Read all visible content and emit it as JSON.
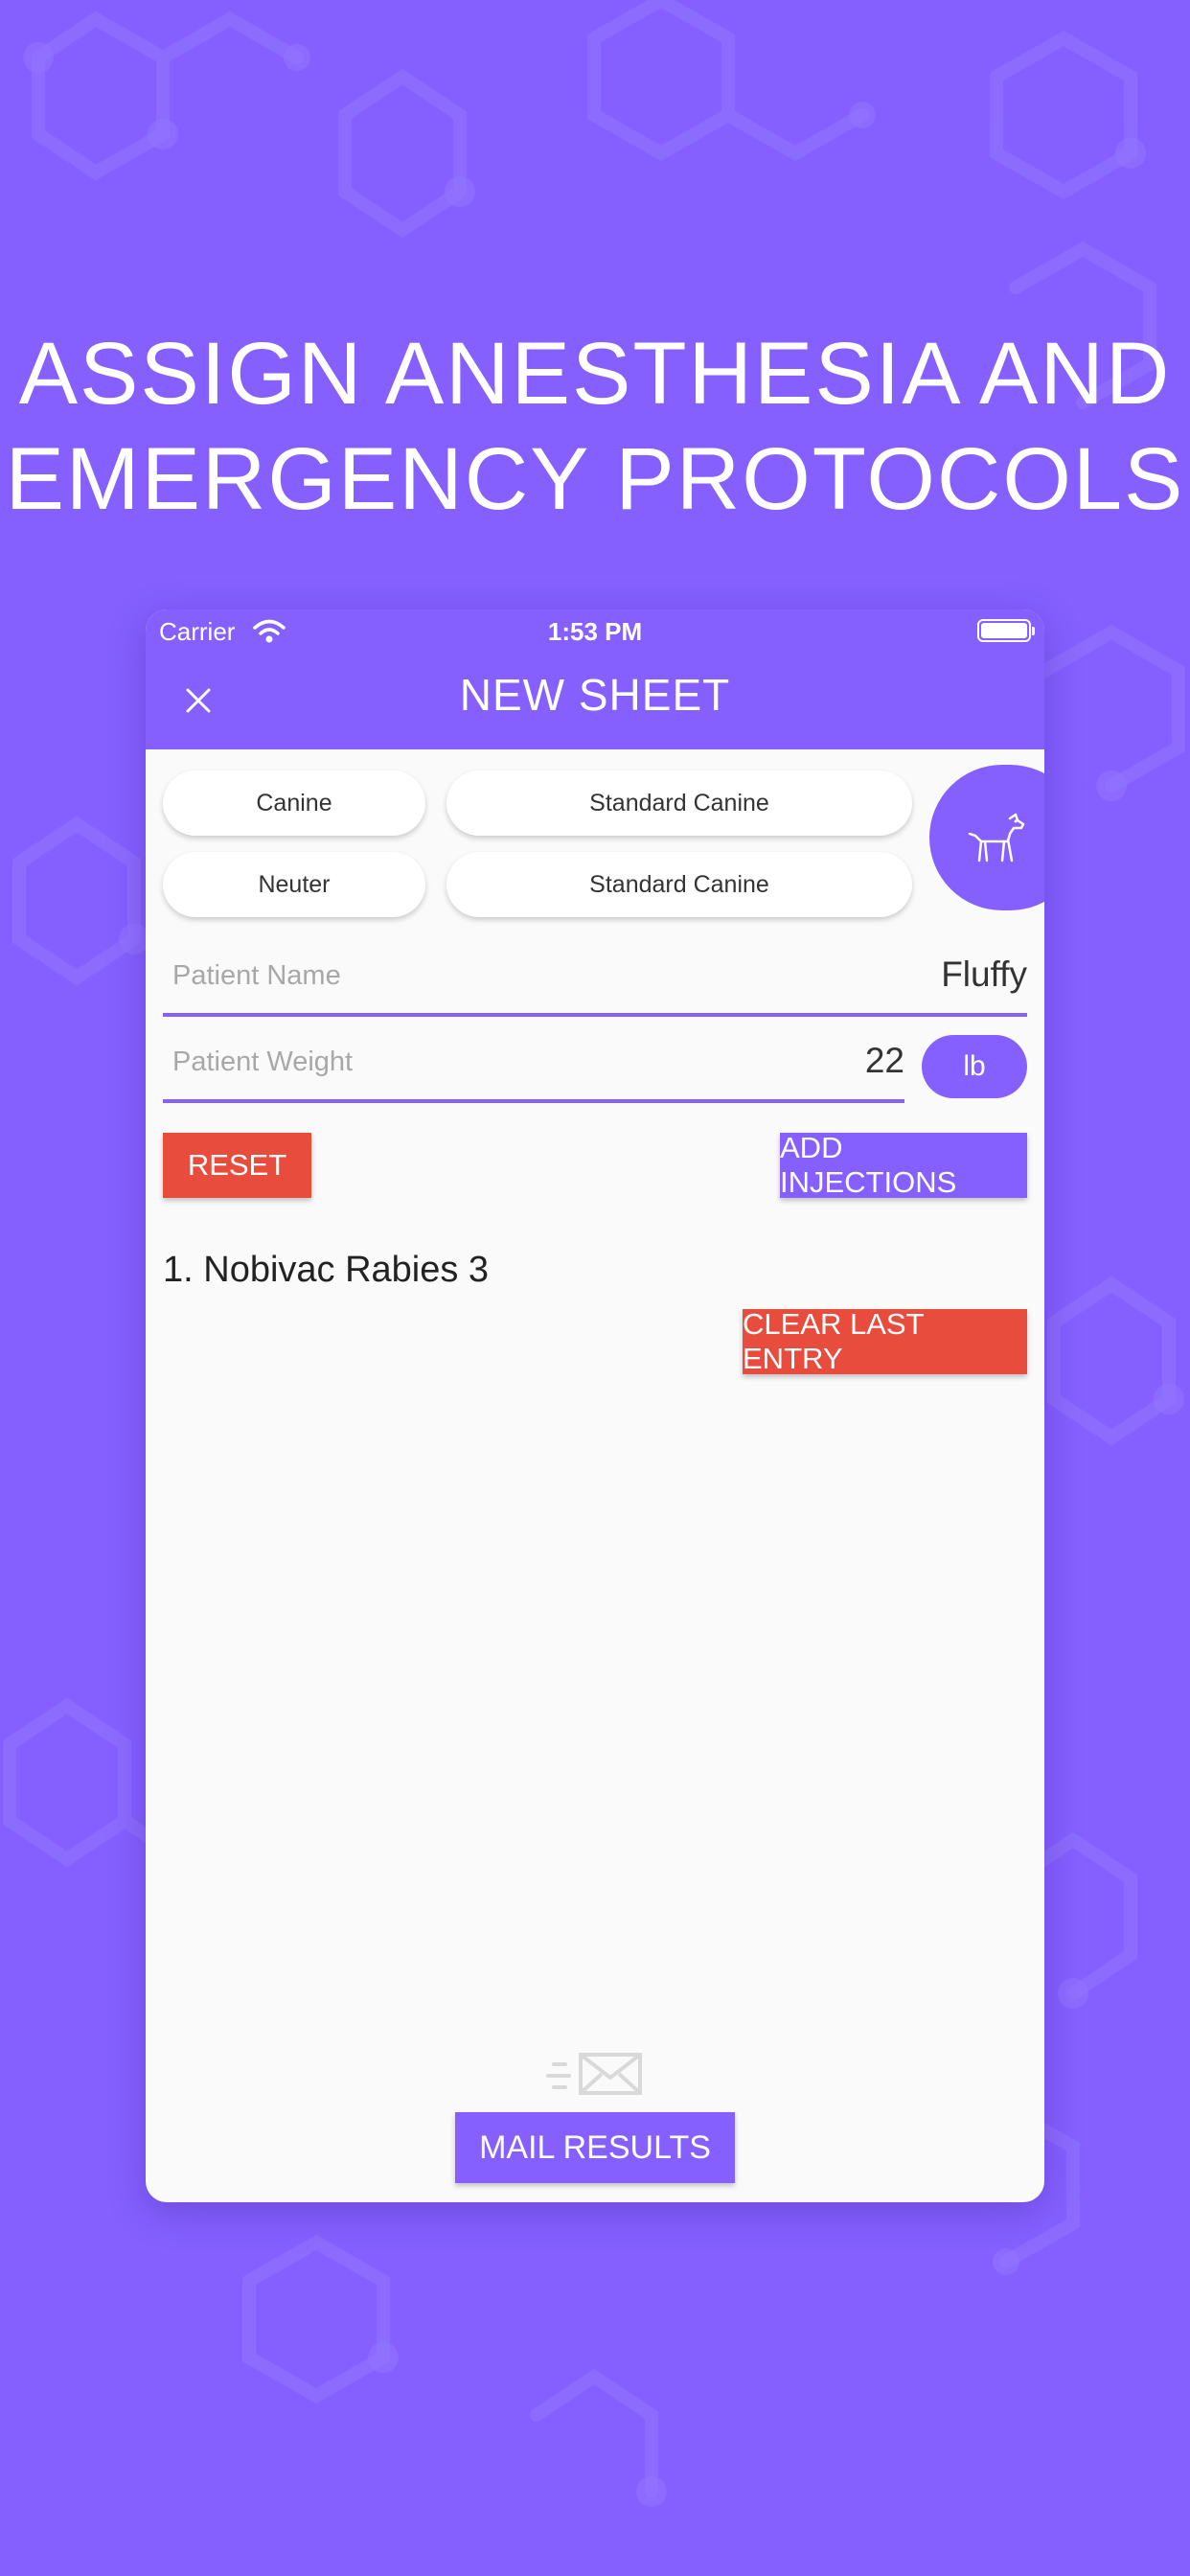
{
  "headline": {
    "line1": "ASSIGN ANESTHESIA AND",
    "line2": "EMERGENCY PROTOCOLS"
  },
  "status_bar": {
    "carrier": "Carrier",
    "time": "1:53 PM"
  },
  "app_bar": {
    "title": "NEW SHEET",
    "close_icon": "close-icon"
  },
  "selectors": {
    "species": "Canine",
    "species_protocol": "Standard Canine",
    "procedure": "Neuter",
    "procedure_protocol": "Standard Canine",
    "avatar_icon": "dog-icon"
  },
  "form": {
    "name_placeholder": "Patient Name",
    "name_value": "Fluffy",
    "weight_placeholder": "Patient Weight",
    "weight_value": "22",
    "weight_unit": "lb"
  },
  "actions": {
    "reset_label": "RESET",
    "add_injections_label": "ADD INJECTIONS",
    "clear_last_label": "CLEAR LAST ENTRY",
    "mail_label": "MAIL RESULTS",
    "mail_icon": "envelope-icon"
  },
  "entries": [
    "1. Nobivac Rabies 3"
  ],
  "colors": {
    "brand_purple": "#8560ff",
    "danger_red": "#e84c3d",
    "sheet_background": "#fafafa"
  }
}
